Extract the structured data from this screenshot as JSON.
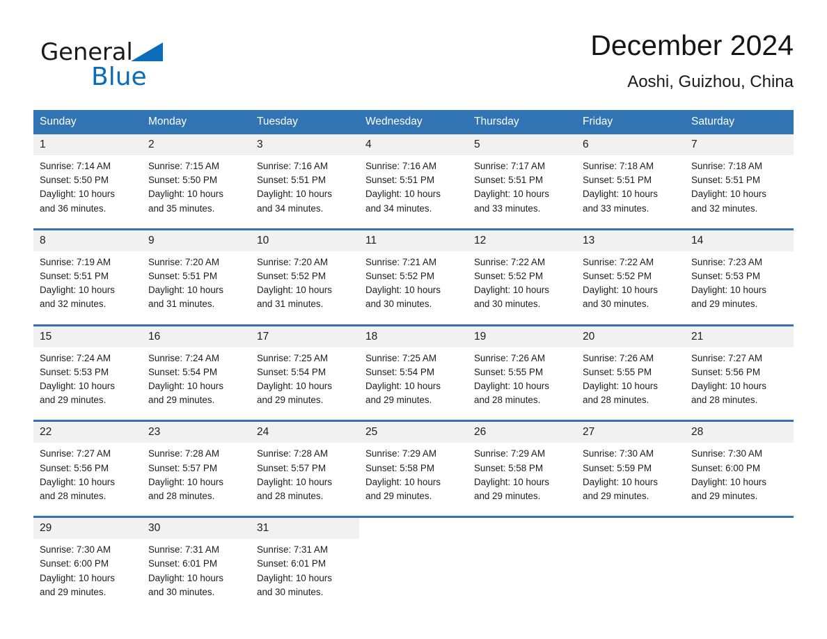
{
  "brand": {
    "name_part1": "General",
    "name_part2": "Blue",
    "triangle_color": "#0b6cb7"
  },
  "header": {
    "title": "December 2024",
    "subtitle": "Aoshi, Guizhou, China"
  },
  "theme": {
    "header_blue": "#3074b4",
    "daynum_gray": "#f1f1f1",
    "text": "#1c1c1c",
    "background": "#ffffff"
  },
  "calendar": {
    "weekday_headers": [
      "Sunday",
      "Monday",
      "Tuesday",
      "Wednesday",
      "Thursday",
      "Friday",
      "Saturday"
    ],
    "weeks": [
      [
        {
          "day": "1",
          "sunrise": "Sunrise: 7:14 AM",
          "sunset": "Sunset: 5:50 PM",
          "daylight_line1": "Daylight: 10 hours",
          "daylight_line2": "and 36 minutes."
        },
        {
          "day": "2",
          "sunrise": "Sunrise: 7:15 AM",
          "sunset": "Sunset: 5:50 PM",
          "daylight_line1": "Daylight: 10 hours",
          "daylight_line2": "and 35 minutes."
        },
        {
          "day": "3",
          "sunrise": "Sunrise: 7:16 AM",
          "sunset": "Sunset: 5:51 PM",
          "daylight_line1": "Daylight: 10 hours",
          "daylight_line2": "and 34 minutes."
        },
        {
          "day": "4",
          "sunrise": "Sunrise: 7:16 AM",
          "sunset": "Sunset: 5:51 PM",
          "daylight_line1": "Daylight: 10 hours",
          "daylight_line2": "and 34 minutes."
        },
        {
          "day": "5",
          "sunrise": "Sunrise: 7:17 AM",
          "sunset": "Sunset: 5:51 PM",
          "daylight_line1": "Daylight: 10 hours",
          "daylight_line2": "and 33 minutes."
        },
        {
          "day": "6",
          "sunrise": "Sunrise: 7:18 AM",
          "sunset": "Sunset: 5:51 PM",
          "daylight_line1": "Daylight: 10 hours",
          "daylight_line2": "and 33 minutes."
        },
        {
          "day": "7",
          "sunrise": "Sunrise: 7:18 AM",
          "sunset": "Sunset: 5:51 PM",
          "daylight_line1": "Daylight: 10 hours",
          "daylight_line2": "and 32 minutes."
        }
      ],
      [
        {
          "day": "8",
          "sunrise": "Sunrise: 7:19 AM",
          "sunset": "Sunset: 5:51 PM",
          "daylight_line1": "Daylight: 10 hours",
          "daylight_line2": "and 32 minutes."
        },
        {
          "day": "9",
          "sunrise": "Sunrise: 7:20 AM",
          "sunset": "Sunset: 5:51 PM",
          "daylight_line1": "Daylight: 10 hours",
          "daylight_line2": "and 31 minutes."
        },
        {
          "day": "10",
          "sunrise": "Sunrise: 7:20 AM",
          "sunset": "Sunset: 5:52 PM",
          "daylight_line1": "Daylight: 10 hours",
          "daylight_line2": "and 31 minutes."
        },
        {
          "day": "11",
          "sunrise": "Sunrise: 7:21 AM",
          "sunset": "Sunset: 5:52 PM",
          "daylight_line1": "Daylight: 10 hours",
          "daylight_line2": "and 30 minutes."
        },
        {
          "day": "12",
          "sunrise": "Sunrise: 7:22 AM",
          "sunset": "Sunset: 5:52 PM",
          "daylight_line1": "Daylight: 10 hours",
          "daylight_line2": "and 30 minutes."
        },
        {
          "day": "13",
          "sunrise": "Sunrise: 7:22 AM",
          "sunset": "Sunset: 5:52 PM",
          "daylight_line1": "Daylight: 10 hours",
          "daylight_line2": "and 30 minutes."
        },
        {
          "day": "14",
          "sunrise": "Sunrise: 7:23 AM",
          "sunset": "Sunset: 5:53 PM",
          "daylight_line1": "Daylight: 10 hours",
          "daylight_line2": "and 29 minutes."
        }
      ],
      [
        {
          "day": "15",
          "sunrise": "Sunrise: 7:24 AM",
          "sunset": "Sunset: 5:53 PM",
          "daylight_line1": "Daylight: 10 hours",
          "daylight_line2": "and 29 minutes."
        },
        {
          "day": "16",
          "sunrise": "Sunrise: 7:24 AM",
          "sunset": "Sunset: 5:54 PM",
          "daylight_line1": "Daylight: 10 hours",
          "daylight_line2": "and 29 minutes."
        },
        {
          "day": "17",
          "sunrise": "Sunrise: 7:25 AM",
          "sunset": "Sunset: 5:54 PM",
          "daylight_line1": "Daylight: 10 hours",
          "daylight_line2": "and 29 minutes."
        },
        {
          "day": "18",
          "sunrise": "Sunrise: 7:25 AM",
          "sunset": "Sunset: 5:54 PM",
          "daylight_line1": "Daylight: 10 hours",
          "daylight_line2": "and 29 minutes."
        },
        {
          "day": "19",
          "sunrise": "Sunrise: 7:26 AM",
          "sunset": "Sunset: 5:55 PM",
          "daylight_line1": "Daylight: 10 hours",
          "daylight_line2": "and 28 minutes."
        },
        {
          "day": "20",
          "sunrise": "Sunrise: 7:26 AM",
          "sunset": "Sunset: 5:55 PM",
          "daylight_line1": "Daylight: 10 hours",
          "daylight_line2": "and 28 minutes."
        },
        {
          "day": "21",
          "sunrise": "Sunrise: 7:27 AM",
          "sunset": "Sunset: 5:56 PM",
          "daylight_line1": "Daylight: 10 hours",
          "daylight_line2": "and 28 minutes."
        }
      ],
      [
        {
          "day": "22",
          "sunrise": "Sunrise: 7:27 AM",
          "sunset": "Sunset: 5:56 PM",
          "daylight_line1": "Daylight: 10 hours",
          "daylight_line2": "and 28 minutes."
        },
        {
          "day": "23",
          "sunrise": "Sunrise: 7:28 AM",
          "sunset": "Sunset: 5:57 PM",
          "daylight_line1": "Daylight: 10 hours",
          "daylight_line2": "and 28 minutes."
        },
        {
          "day": "24",
          "sunrise": "Sunrise: 7:28 AM",
          "sunset": "Sunset: 5:57 PM",
          "daylight_line1": "Daylight: 10 hours",
          "daylight_line2": "and 28 minutes."
        },
        {
          "day": "25",
          "sunrise": "Sunrise: 7:29 AM",
          "sunset": "Sunset: 5:58 PM",
          "daylight_line1": "Daylight: 10 hours",
          "daylight_line2": "and 29 minutes."
        },
        {
          "day": "26",
          "sunrise": "Sunrise: 7:29 AM",
          "sunset": "Sunset: 5:58 PM",
          "daylight_line1": "Daylight: 10 hours",
          "daylight_line2": "and 29 minutes."
        },
        {
          "day": "27",
          "sunrise": "Sunrise: 7:30 AM",
          "sunset": "Sunset: 5:59 PM",
          "daylight_line1": "Daylight: 10 hours",
          "daylight_line2": "and 29 minutes."
        },
        {
          "day": "28",
          "sunrise": "Sunrise: 7:30 AM",
          "sunset": "Sunset: 6:00 PM",
          "daylight_line1": "Daylight: 10 hours",
          "daylight_line2": "and 29 minutes."
        }
      ],
      [
        {
          "day": "29",
          "sunrise": "Sunrise: 7:30 AM",
          "sunset": "Sunset: 6:00 PM",
          "daylight_line1": "Daylight: 10 hours",
          "daylight_line2": "and 29 minutes."
        },
        {
          "day": "30",
          "sunrise": "Sunrise: 7:31 AM",
          "sunset": "Sunset: 6:01 PM",
          "daylight_line1": "Daylight: 10 hours",
          "daylight_line2": "and 30 minutes."
        },
        {
          "day": "31",
          "sunrise": "Sunrise: 7:31 AM",
          "sunset": "Sunset: 6:01 PM",
          "daylight_line1": "Daylight: 10 hours",
          "daylight_line2": "and 30 minutes."
        },
        {
          "day": "",
          "sunrise": "",
          "sunset": "",
          "daylight_line1": "",
          "daylight_line2": ""
        },
        {
          "day": "",
          "sunrise": "",
          "sunset": "",
          "daylight_line1": "",
          "daylight_line2": ""
        },
        {
          "day": "",
          "sunrise": "",
          "sunset": "",
          "daylight_line1": "",
          "daylight_line2": ""
        },
        {
          "day": "",
          "sunrise": "",
          "sunset": "",
          "daylight_line1": "",
          "daylight_line2": ""
        }
      ]
    ]
  }
}
